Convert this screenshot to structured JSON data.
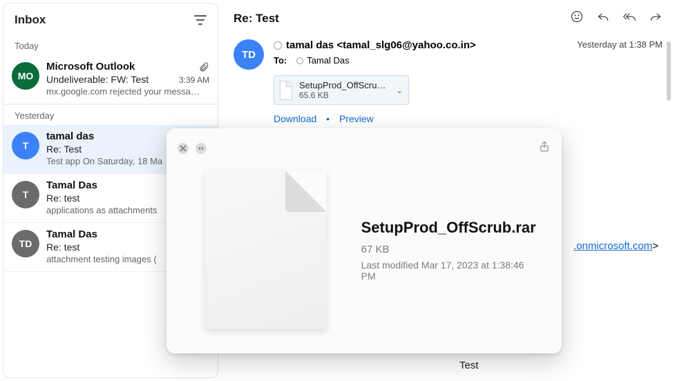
{
  "sidebar": {
    "title": "Inbox",
    "sections": [
      {
        "label": "Today"
      },
      {
        "label": "Yesterday"
      }
    ],
    "messages": [
      {
        "avatar_text": "MO",
        "avatar_class": "green",
        "sender": "Microsoft Outlook",
        "has_attachment": true,
        "time": "3:39 AM",
        "subject": "Undeliverable: FW: Test",
        "preview": "mx.google.com rejected your messa…",
        "selected": false
      },
      {
        "avatar_text": "T",
        "avatar_class": "blue",
        "sender": "tamal das",
        "has_attachment": false,
        "time": "",
        "subject": "Re: Test",
        "preview": "Test app On Saturday, 18 Ma",
        "selected": true
      },
      {
        "avatar_text": "T",
        "avatar_class": "grey",
        "sender": "Tamal Das",
        "has_attachment": false,
        "time": "",
        "subject": "Re: test",
        "preview": "applications as attachments",
        "selected": false
      },
      {
        "avatar_text": "TD",
        "avatar_class": "grey",
        "sender": "Tamal Das",
        "has_attachment": false,
        "time": "",
        "subject": "Re: test",
        "preview": "attachment testing images (",
        "selected": false
      }
    ]
  },
  "reader": {
    "subject": "Re: Test",
    "avatar_text": "TD",
    "from_name": "tamal das",
    "from_addr": "<tamal_slg06@yahoo.co.in>",
    "timestamp": "Yesterday at 1:38 PM",
    "to_label": "To:",
    "to_name": "Tamal Das",
    "attachment": {
      "name": "SetupProd_OffScrub…",
      "size": "65.6 KB"
    },
    "download_label": "Download",
    "preview_label": "Preview",
    "body_text": "Test",
    "peek_link_text": ".onmicrosoft.com",
    "peek_link_tail": ">"
  },
  "quicklook": {
    "file_name": "SetupProd_OffScrub.rar",
    "file_size": "67 KB",
    "modified": "Last modified Mar 17, 2023 at 1:38:46 PM"
  }
}
